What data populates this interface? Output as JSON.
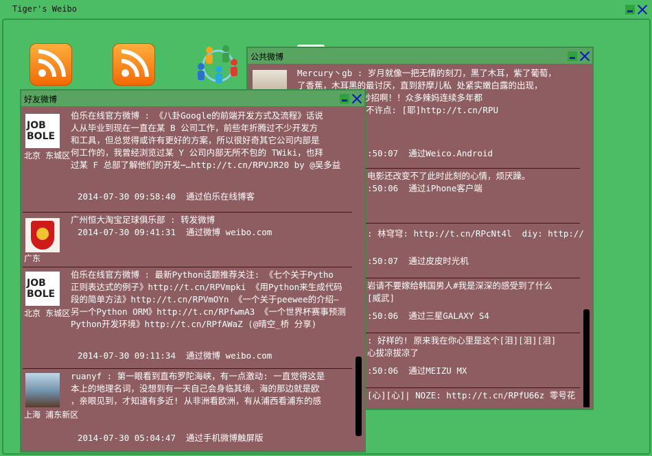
{
  "app": {
    "title": "Tiger's Weibo"
  },
  "desktop_icons": [
    {
      "name": "rss-icon-1"
    },
    {
      "name": "rss-icon-2"
    },
    {
      "name": "people-icon"
    }
  ],
  "public_window": {
    "title": "公共微博",
    "posts": [
      {
        "text": "Mercury丶gb : 岁月就像一把无情的刻刀，黑了木耳，紫了葡萄，\n了香蕉，木耳黑的最讨厌，直到舒摩儿私 处紧实嫩白露的出现，\n变粉嫩， 其实有妙招啊！！众多辣妈连续多年都\n秘密哈，软香蕉们不许点: [耶]http://t.cn/RPU",
        "meta": ":50:07  通过Weico.Android"
      },
      {
        "text": "电影还改变不了此时此刻的心情，烦厌躁。",
        "meta": ":50:06  通过iPhone客户端"
      },
      {
        "text": ": 林穹穹: http://t.cn/RPcNt4l  diy: http://",
        "meta": ":50:07  通过皮皮时光机"
      },
      {
        "text": "岩请不要嫁给韩国男人#我是深深的感受到了什么\n[威武]",
        "meta": ":50:06  通过三星GALAXY S4"
      },
      {
        "text": ": 好样的! 原来我在你心里是这个[泪][泪][泪]\n心拔凉拔凉了",
        "meta": ":50:06  通过MEIZU MX"
      },
      {
        "text": "[心][心]| NOZE: http://t.cn/RPfU66z 零号花",
        "meta": ""
      }
    ]
  },
  "friends_window": {
    "title": "好友微博",
    "posts": [
      {
        "avatar": "jobbole-logo",
        "location": "北京 东城区",
        "text": "伯乐在线官方微博 : 《八卦Google的前端开发方式及流程》话说\n人从毕业到现在一直在某 B 公司工作，前些年折腾过不少开发方\n和工具，但总觉得或许有更好的方案，所以很好奇其它公司内部是\n何工作的，我曾经浏览过某 Y 公司内部无所不包的 TWiki，也拜\n过某 F 总部了解他们的开发⋯…http://t.cn/RPVJR20 by @吴多益",
        "meta": "2014-07-30 09:58:40  通过伯乐在线博客"
      },
      {
        "avatar": "club-logo",
        "location": "广东",
        "text": "广州恒大淘宝足球俱乐部 : 转发微博",
        "meta": "2014-07-30 09:41:31  通过微博 weibo.com"
      },
      {
        "avatar": "jobbole-logo",
        "location": "北京 东城区",
        "text": "伯乐在线官方微博 : 最新Python话题推荐关注: 《七个关于Pytho\n正则表达式的例子》http://t.cn/RPVmpki 《用Python来生成代码\n段的简单方法》http://t.cn/RPVmOYn 《一个关于peewee的介绍—\n另一个Python ORM》http://t.cn/RPfwmA3 《一个世界杯赛事预测\nPython开发环境》http://t.cn/RPfAWaZ (@晴空_桥 分享)",
        "meta": "2014-07-30 09:11:34  通过微博 weibo.com"
      },
      {
        "avatar": "user-photo",
        "location": "上海 浦东新区",
        "text": "ruanyf : 第一眼看到直布罗陀海峡，有一点激动: 一直觉得这是\n本上的地理名词，没想到有一天自己会身临其境。海的那边就是欧\n，亲眼见到，才知道有多近! 从非洲看欧洲，有从浦西看浦东的感",
        "meta": "2014-07-30 05:04:47  通过手机微博触屏版"
      }
    ]
  },
  "colors": {
    "background": "#4bbd64",
    "window_body": "#8e5d61",
    "titlebar": "#5aa462",
    "button_blue": "#0a1ab8"
  }
}
